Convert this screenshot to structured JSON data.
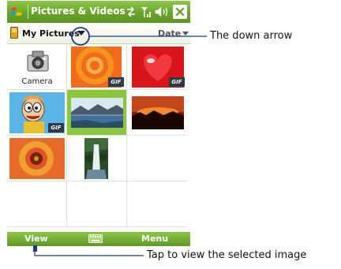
{
  "titlebar": {
    "title": "Pictures & Videos",
    "icons": [
      "windows-flag-icon",
      "sync-icon",
      "signal-icon",
      "volume-icon",
      "close-icon"
    ]
  },
  "folderbar": {
    "folder": "My Pictures",
    "sort": "Date"
  },
  "grid": {
    "camera_label": "Camera",
    "gif_badge": "GIF",
    "selected_index": 4
  },
  "softkeys": {
    "left": "View",
    "right": "Menu",
    "center_icon": "keyboard-icon"
  },
  "annotations": {
    "down_arrow": "The down arrow",
    "view": "Tap to view the selected image"
  },
  "colors": {
    "accent": "#6aa42c",
    "selected": "#8cc63f"
  }
}
